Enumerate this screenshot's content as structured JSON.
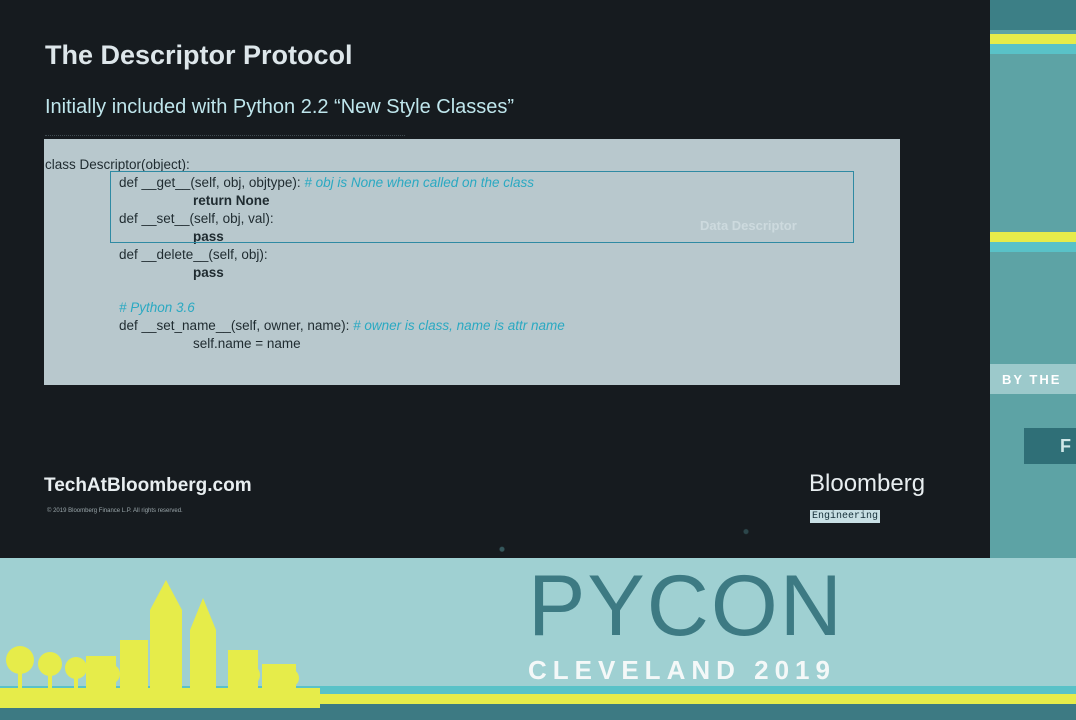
{
  "slide": {
    "title": "The Descriptor Protocol",
    "subtitle": "Initially included with Python 2.2 “New Style Classes”",
    "code": {
      "line1": "class Descriptor(object):",
      "line2_code": "def __get__(self, obj, objtype):",
      "line2_comment": " # obj is None when called on the class",
      "line3": "return None",
      "line4": "def __set__(self, obj, val):",
      "line5": "pass",
      "line6": "def __delete__(self, obj):",
      "line7": "pass",
      "line8_comment": "# Python 3.6",
      "line9_code": "def __set_name__(self, owner, name):",
      "line9_comment": " # owner is class, name is attr name",
      "line10": "self.name = name"
    },
    "faint_label": "Data Descriptor",
    "site_link": "TechAtBloomberg.com",
    "copyright": "© 2019 Bloomberg Finance L.P. All rights reserved.",
    "brand": "Bloomberg",
    "brand_sub": "Engineering"
  },
  "side": {
    "band_text": "BY THE",
    "flag_text": "F"
  },
  "banner": {
    "big": "PYCON",
    "small": "CLEVELAND 2019"
  },
  "colors": {
    "slide_bg": "#161b1f",
    "code_bg": "#b8c8cd",
    "accent_teal": "#5da3a5",
    "accent_yellow": "#e6ec4a"
  }
}
